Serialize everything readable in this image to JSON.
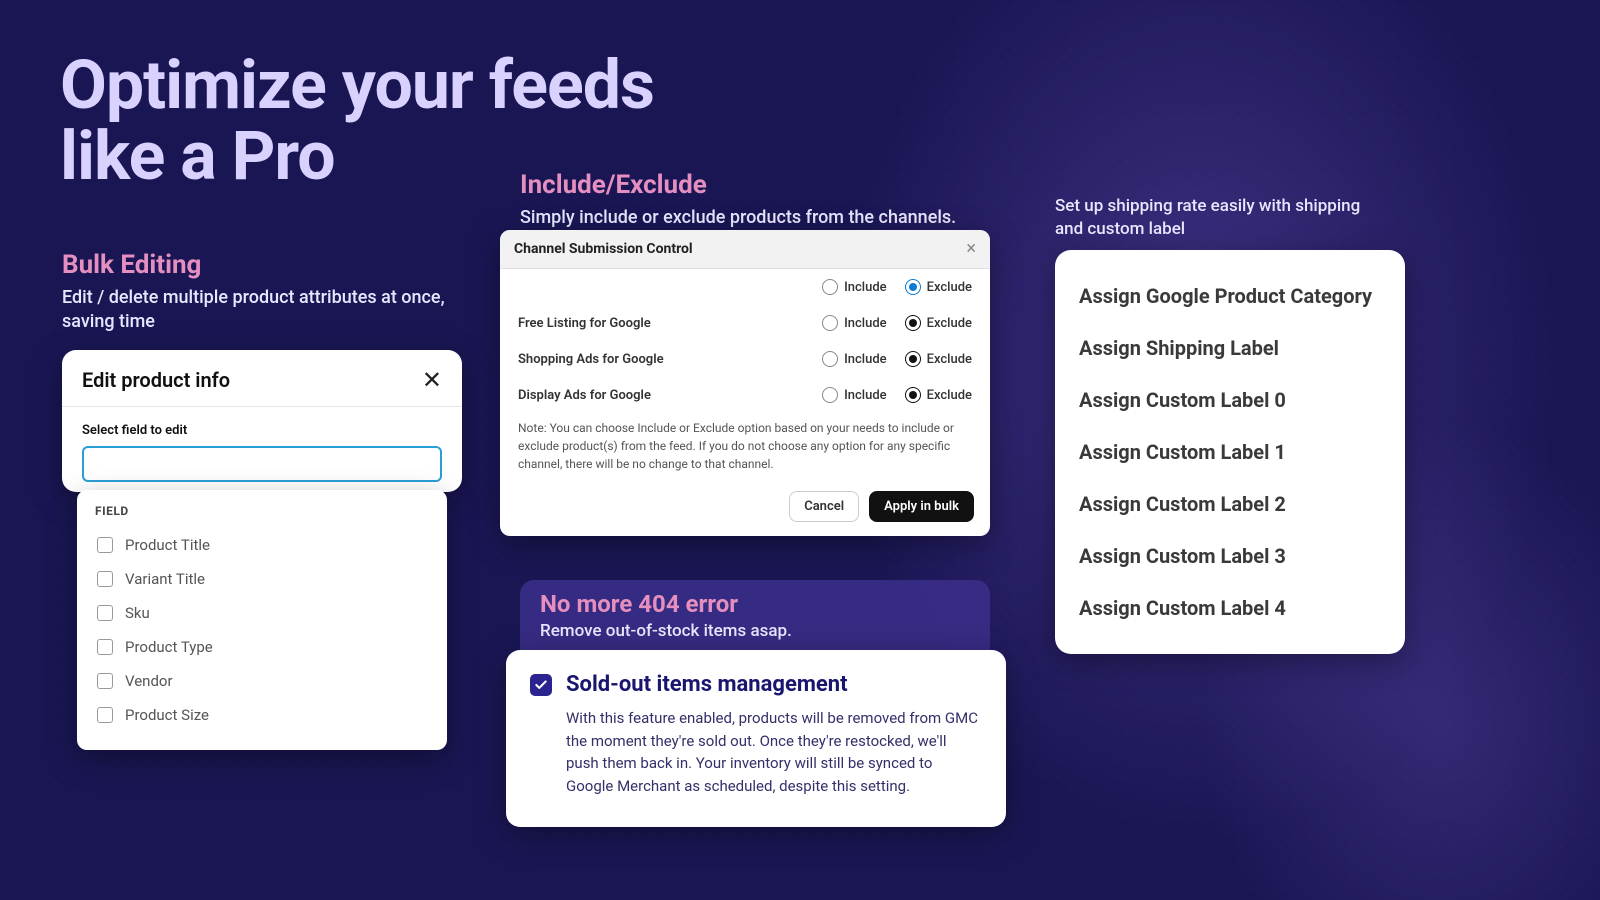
{
  "hero": {
    "line1": "Optimize your feeds",
    "line2": "like a Pro"
  },
  "bulk": {
    "title": "Bulk Editing",
    "sub": "Edit / delete multiple product attributes at once, saving time",
    "card_title": "Edit product info",
    "select_label": "Select field to edit",
    "field_header": "FIELD",
    "fields": [
      "Product Title",
      "Variant Title",
      "Sku",
      "Product Type",
      "Vendor",
      "Product Size"
    ]
  },
  "incex": {
    "title": "Include/Exclude",
    "sub": "Simply include or exclude products from the channels.",
    "panel_title": "Channel Submission Control",
    "include_label": "Include",
    "exclude_label": "Exclude",
    "rows": [
      "Free Listing for Google",
      "Shopping Ads for Google",
      "Display Ads for Google"
    ],
    "note": "Note: You can choose Include or Exclude option based on your needs to include or exclude product(s) from the feed. If you do not choose any option for any specific channel, there will be no change to that channel.",
    "cancel": "Cancel",
    "apply": "Apply in bulk"
  },
  "nomore": {
    "title": "No more 404 error",
    "sub": "Remove out-of-stock items asap.",
    "card_title": "Sold-out items management",
    "card_body": "With this feature enabled, products will be removed from GMC the moment they're sold out. Once they're restocked, we'll push them back in. Your inventory will still be synced to Google Merchant as scheduled, despite this setting."
  },
  "shipping": {
    "sub": "Set up shipping rate easily with shipping and custom label",
    "items": [
      "Assign Google Product Category",
      "Assign Shipping Label",
      "Assign Custom Label 0",
      "Assign Custom Label 1",
      "Assign Custom Label 2",
      "Assign Custom Label 3",
      "Assign Custom Label 4"
    ]
  }
}
